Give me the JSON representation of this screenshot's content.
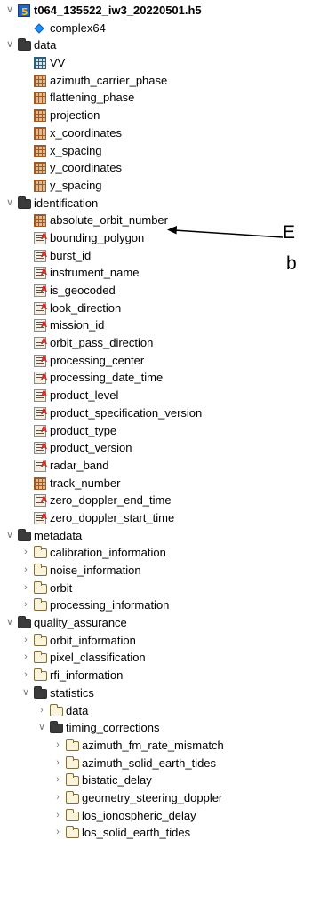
{
  "tree": {
    "root": {
      "label": "t064_135522_iw3_20220501.h5",
      "icon": "hdf5-file-icon"
    },
    "complex64": {
      "label": "complex64",
      "icon": "datatype-icon"
    },
    "data": {
      "label": "data",
      "children": [
        "VV",
        "azimuth_carrier_phase",
        "flattening_phase",
        "projection",
        "x_coordinates",
        "x_spacing",
        "y_coordinates",
        "y_spacing"
      ]
    },
    "identification": {
      "label": "identification",
      "children": [
        {
          "label": "absolute_orbit_number",
          "kind": "dataset"
        },
        {
          "label": "bounding_polygon",
          "kind": "string"
        },
        {
          "label": "burst_id",
          "kind": "string"
        },
        {
          "label": "instrument_name",
          "kind": "string"
        },
        {
          "label": "is_geocoded",
          "kind": "string"
        },
        {
          "label": "look_direction",
          "kind": "string"
        },
        {
          "label": "mission_id",
          "kind": "string"
        },
        {
          "label": "orbit_pass_direction",
          "kind": "string"
        },
        {
          "label": "processing_center",
          "kind": "string"
        },
        {
          "label": "processing_date_time",
          "kind": "string"
        },
        {
          "label": "product_level",
          "kind": "string"
        },
        {
          "label": "product_specification_version",
          "kind": "string"
        },
        {
          "label": "product_type",
          "kind": "string"
        },
        {
          "label": "product_version",
          "kind": "string"
        },
        {
          "label": "radar_band",
          "kind": "string"
        },
        {
          "label": "track_number",
          "kind": "dataset"
        },
        {
          "label": "zero_doppler_end_time",
          "kind": "string"
        },
        {
          "label": "zero_doppler_start_time",
          "kind": "string"
        }
      ]
    },
    "metadata": {
      "label": "metadata",
      "children": [
        "calibration_information",
        "noise_information",
        "orbit",
        "processing_information"
      ]
    },
    "quality_assurance": {
      "label": "quality_assurance",
      "children": [
        "orbit_information",
        "pixel_classification",
        "rfi_information"
      ],
      "statistics": {
        "label": "statistics",
        "data": "data",
        "timing_corrections": {
          "label": "timing_corrections",
          "children": [
            "azimuth_fm_rate_mismatch",
            "azimuth_solid_earth_tides",
            "bistatic_delay",
            "geometry_steering_doppler",
            "los_ionospheric_delay",
            "los_solid_earth_tides"
          ]
        }
      }
    }
  },
  "annotation": {
    "line1": "E",
    "line2": "b"
  }
}
